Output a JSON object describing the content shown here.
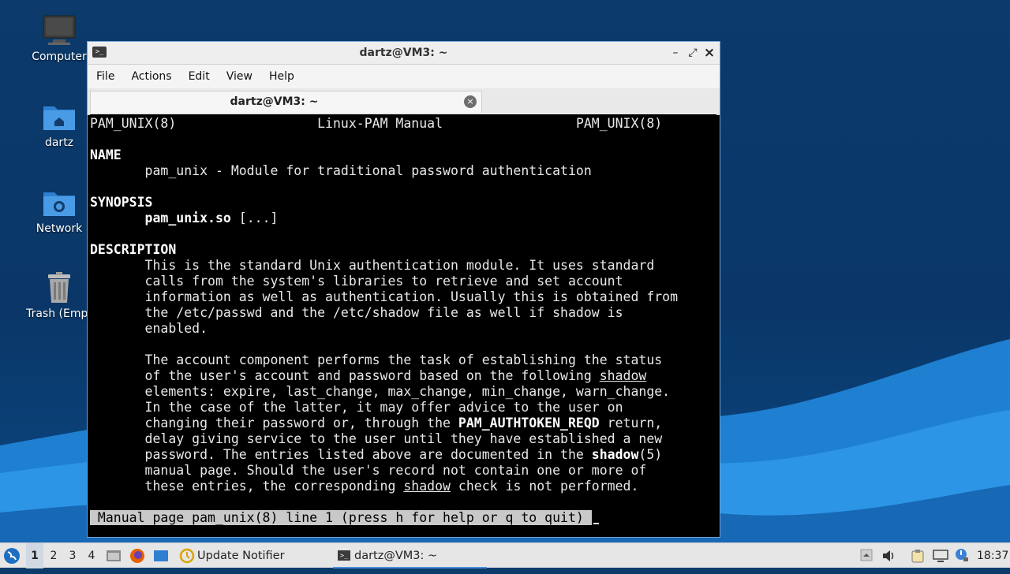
{
  "desktop": {
    "icons": [
      {
        "label": "Computer"
      },
      {
        "label": "dartz"
      },
      {
        "label": "Network"
      },
      {
        "label": "Trash (Empt"
      }
    ]
  },
  "window": {
    "title": "dartz@VM3: ~",
    "menu": [
      "File",
      "Actions",
      "Edit",
      "View",
      "Help"
    ],
    "tab_label": "dartz@VM3: ~",
    "controls": {
      "minimize": "–",
      "maximize": "⤢",
      "close": "×"
    }
  },
  "terminal": {
    "header_left": "PAM_UNIX(8)",
    "header_center": "Linux-PAM Manual",
    "header_right": "PAM_UNIX(8)",
    "name_heading": "NAME",
    "name_text": "pam_unix - Module for traditional password authentication",
    "synopsis_heading": "SYNOPSIS",
    "synopsis_cmd": "pam_unix.so",
    "synopsis_args": " [...]",
    "description_heading": "DESCRIPTION",
    "desc_p1": [
      "This is the standard Unix authentication module. It uses standard",
      "calls from the system's libraries to retrieve and set account",
      "information as well as authentication. Usually this is obtained from",
      "the /etc/passwd and the /etc/shadow file as well if shadow is",
      "enabled."
    ],
    "desc_p2_l1": "The account component performs the task of establishing the status",
    "desc_p2_l2a": "of the user's account and password based on the following ",
    "desc_p2_l2b": "shadow",
    "desc_p2_l3": "elements: expire, last_change, max_change, min_change, warn_change.",
    "desc_p2_l4": "In the case of the latter, it may offer advice to the user on",
    "desc_p2_l5a": "changing their password or, through the ",
    "desc_p2_l5b": "PAM_AUTHTOKEN_REQD",
    "desc_p2_l5c": " return,",
    "desc_p2_l6": "delay giving service to the user until they have established a new",
    "desc_p2_l7a": "password. The entries listed above are documented in the ",
    "desc_p2_l7b": "shadow",
    "desc_p2_l7c": "(5)",
    "desc_p2_l8": "manual page. Should the user's record not contain one or more of",
    "desc_p2_l9a": "these entries, the corresponding ",
    "desc_p2_l9b": "shadow",
    "desc_p2_l9c": " check is not performed.",
    "status_line": " Manual page pam_unix(8) line 1 (press h for help or q to quit) "
  },
  "taskbar": {
    "workspaces": [
      "1",
      "2",
      "3",
      "4"
    ],
    "active_workspace": "1",
    "update_notifier": "Update Notifier",
    "task_label": "dartz@VM3: ~",
    "clock": "18:37"
  }
}
